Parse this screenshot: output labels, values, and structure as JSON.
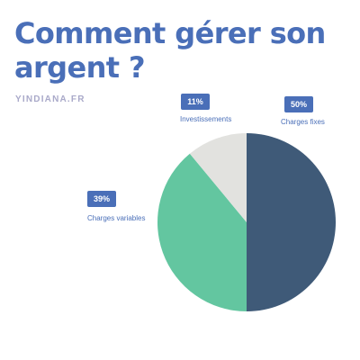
{
  "header": {
    "title": "Comment gérer son argent ?",
    "brand": "YINDIANA.FR"
  },
  "colors": {
    "accent": "#4a6fb8",
    "brand_text": "#a9a9c9",
    "charges_fixes": "#3f5a78",
    "charges_variables": "#63c6a0",
    "investissements": "#e2e2df"
  },
  "chart_data": {
    "type": "pie",
    "title": "Comment gérer son argent ?",
    "slices": [
      {
        "label": "Charges fixes",
        "value": 50,
        "value_label": "50%",
        "color": "#3f5a78"
      },
      {
        "label": "Charges variables",
        "value": 39,
        "value_label": "39%",
        "color": "#63c6a0"
      },
      {
        "label": "Investissements",
        "value": 11,
        "value_label": "11%",
        "color": "#e2e2df"
      }
    ],
    "legend": "none"
  }
}
